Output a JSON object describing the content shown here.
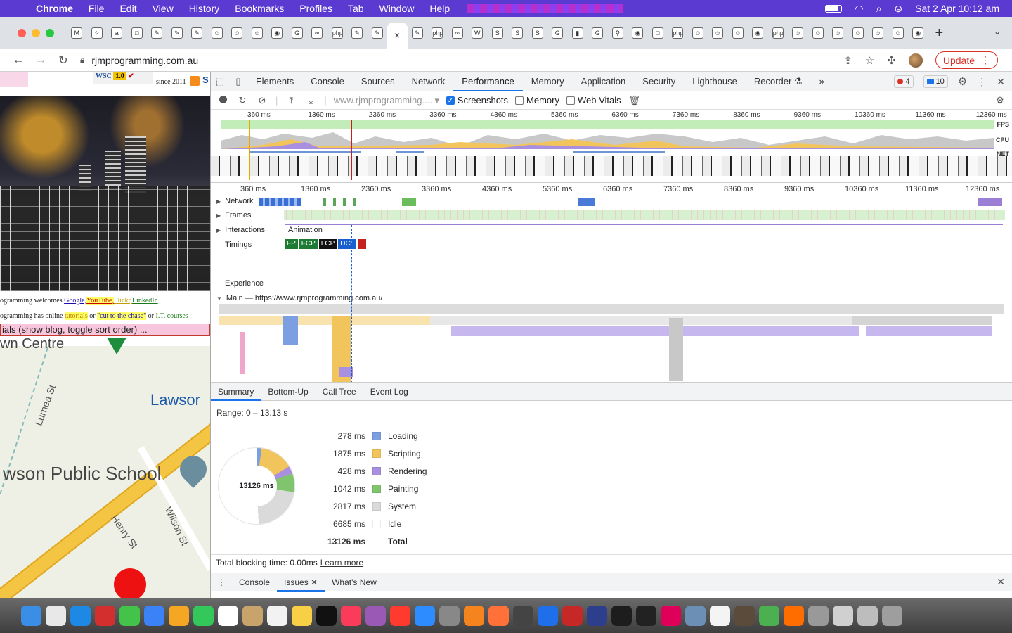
{
  "menubar": {
    "app": "Chrome",
    "items": [
      "File",
      "Edit",
      "View",
      "History",
      "Bookmarks",
      "Profiles",
      "Tab",
      "Window",
      "Help"
    ],
    "datetime": "Sat 2 Apr  10:12 am"
  },
  "tabs": {
    "favicons": [
      "M",
      "✧",
      "a",
      "□",
      "✎",
      "✎",
      "✎",
      "☺",
      "☺",
      "☺",
      "◉",
      "G",
      "∞",
      "php",
      "✎",
      "✎",
      "×",
      "✎",
      "php",
      "∞",
      "W",
      "S",
      "S",
      "S",
      "G",
      "▮",
      "G",
      "⚲",
      "◉",
      "□",
      "php",
      "☺",
      "☺",
      "☺",
      "◉",
      "php",
      "☺",
      "☺",
      "☺",
      "☺",
      "☺",
      "☺",
      "◉"
    ],
    "active_index": 16,
    "new_tab": "+",
    "menu": "⌄"
  },
  "address": {
    "url": "rjmprogramming.com.au",
    "update_label": "Update"
  },
  "page": {
    "w3c": "WSC",
    "w3c_version": "1.0",
    "since": "since 2011",
    "welcome_prefix": "ogramming welcomes ",
    "welcome_links": [
      "Google,",
      "YouTube,",
      "Flickr,",
      "LinkedIn"
    ],
    "courses_prefix": "ogramming has online ",
    "courses_link1": "tutorials",
    "courses_or": " or ",
    "courses_link2": "\"cut to the chase\"",
    "courses_or2": " or ",
    "courses_link3": "I.T. courses",
    "pinkbar": "ials (show blog, toggle sort order) ...",
    "map_top": "wn Centre",
    "map_lawson": "Lawsor",
    "map_school": "wson Public School",
    "streets": [
      "Lurnea St",
      "Henry St",
      "Wilson St"
    ]
  },
  "devtools": {
    "tabs": [
      "Elements",
      "Console",
      "Sources",
      "Network",
      "Performance",
      "Memory",
      "Application",
      "Security",
      "Lighthouse",
      "Recorder ⚗"
    ],
    "active_tab": "Performance",
    "more": "»",
    "errors": "4",
    "messages": "10",
    "toolbar": {
      "profile_select": "www.rjmprogramming....",
      "screenshots_label": "Screenshots",
      "memory_label": "Memory",
      "webvitals_label": "Web Vitals"
    },
    "overview_ticks": [
      "360 ms",
      "1360 ms",
      "2360 ms",
      "3360 ms",
      "4360 ms",
      "5360 ms",
      "6360 ms",
      "7360 ms",
      "8360 ms",
      "9360 ms",
      "10360 ms",
      "11360 ms",
      "12360 ms"
    ],
    "lane_labels": {
      "fps": "FPS",
      "cpu": "CPU",
      "net": "NET"
    },
    "timeline_ticks": [
      "360 ms",
      "1360 ms",
      "2360 ms",
      "3360 ms",
      "4360 ms",
      "5360 ms",
      "6360 ms",
      "7360 ms",
      "8360 ms",
      "9360 ms",
      "10360 ms",
      "11360 ms",
      "12360 ms"
    ],
    "tracks": {
      "network": "Network",
      "frames": "Frames",
      "interactions": "Interactions",
      "timings": "Timings",
      "experience": "Experience",
      "main": "Main — https://www.rjmprogramming.com.au/",
      "animation": "Animation"
    },
    "timings": [
      {
        "label": "FP",
        "color": "#1e7b34"
      },
      {
        "label": "FCP",
        "color": "#1e7b34"
      },
      {
        "label": "LCP",
        "color": "#111111"
      },
      {
        "label": "DCL",
        "color": "#1a5fd0"
      },
      {
        "label": "L",
        "color": "#c5221f"
      }
    ],
    "subtabs": [
      "Summary",
      "Bottom-Up",
      "Call Tree",
      "Event Log"
    ],
    "active_subtab": "Summary",
    "summary": {
      "range": "Range: 0 – 13.13 s",
      "total_center": "13126 ms",
      "rows": [
        {
          "ms": "278 ms",
          "name": "Loading",
          "value": 278,
          "color": "#7b9fe0"
        },
        {
          "ms": "1875 ms",
          "name": "Scripting",
          "value": 1875,
          "color": "#f2c55c"
        },
        {
          "ms": "428 ms",
          "name": "Rendering",
          "value": 428,
          "color": "#a98fe0"
        },
        {
          "ms": "1042 ms",
          "name": "Painting",
          "value": 1042,
          "color": "#80c46e"
        },
        {
          "ms": "2817 ms",
          "name": "System",
          "value": 2817,
          "color": "#dadada"
        },
        {
          "ms": "6685 ms",
          "name": "Idle",
          "value": 6685,
          "color": "#ffffff"
        }
      ],
      "total": {
        "ms": "13126 ms",
        "name": "Total"
      }
    },
    "blocking_text": "Total blocking time: 0.00ms",
    "learn_more": "Learn more",
    "drawer": {
      "tabs": [
        "Console",
        "Issues",
        "What's New"
      ],
      "active": "Issues"
    }
  },
  "dock": {
    "apps": [
      "Finder",
      "Launchpad",
      "Safari",
      "Opera",
      "Messages",
      "Mail",
      "Photos",
      "FaceTime",
      "Calendar",
      "Contacts",
      "Reminders",
      "Notes",
      "TV",
      "Music",
      "Podcasts",
      "News",
      "App Store",
      "System Preferences",
      "Blender",
      "Firefox",
      "Calculator",
      "Xcode",
      "FileZilla",
      "BBEdit",
      "Terminal",
      "GitHub",
      "IntelliJ",
      "Preview",
      "TextEdit",
      "GIMP",
      "Chrome",
      "Firefox Dev",
      "Automator",
      "Documents",
      "Downloads",
      "Trash"
    ]
  }
}
